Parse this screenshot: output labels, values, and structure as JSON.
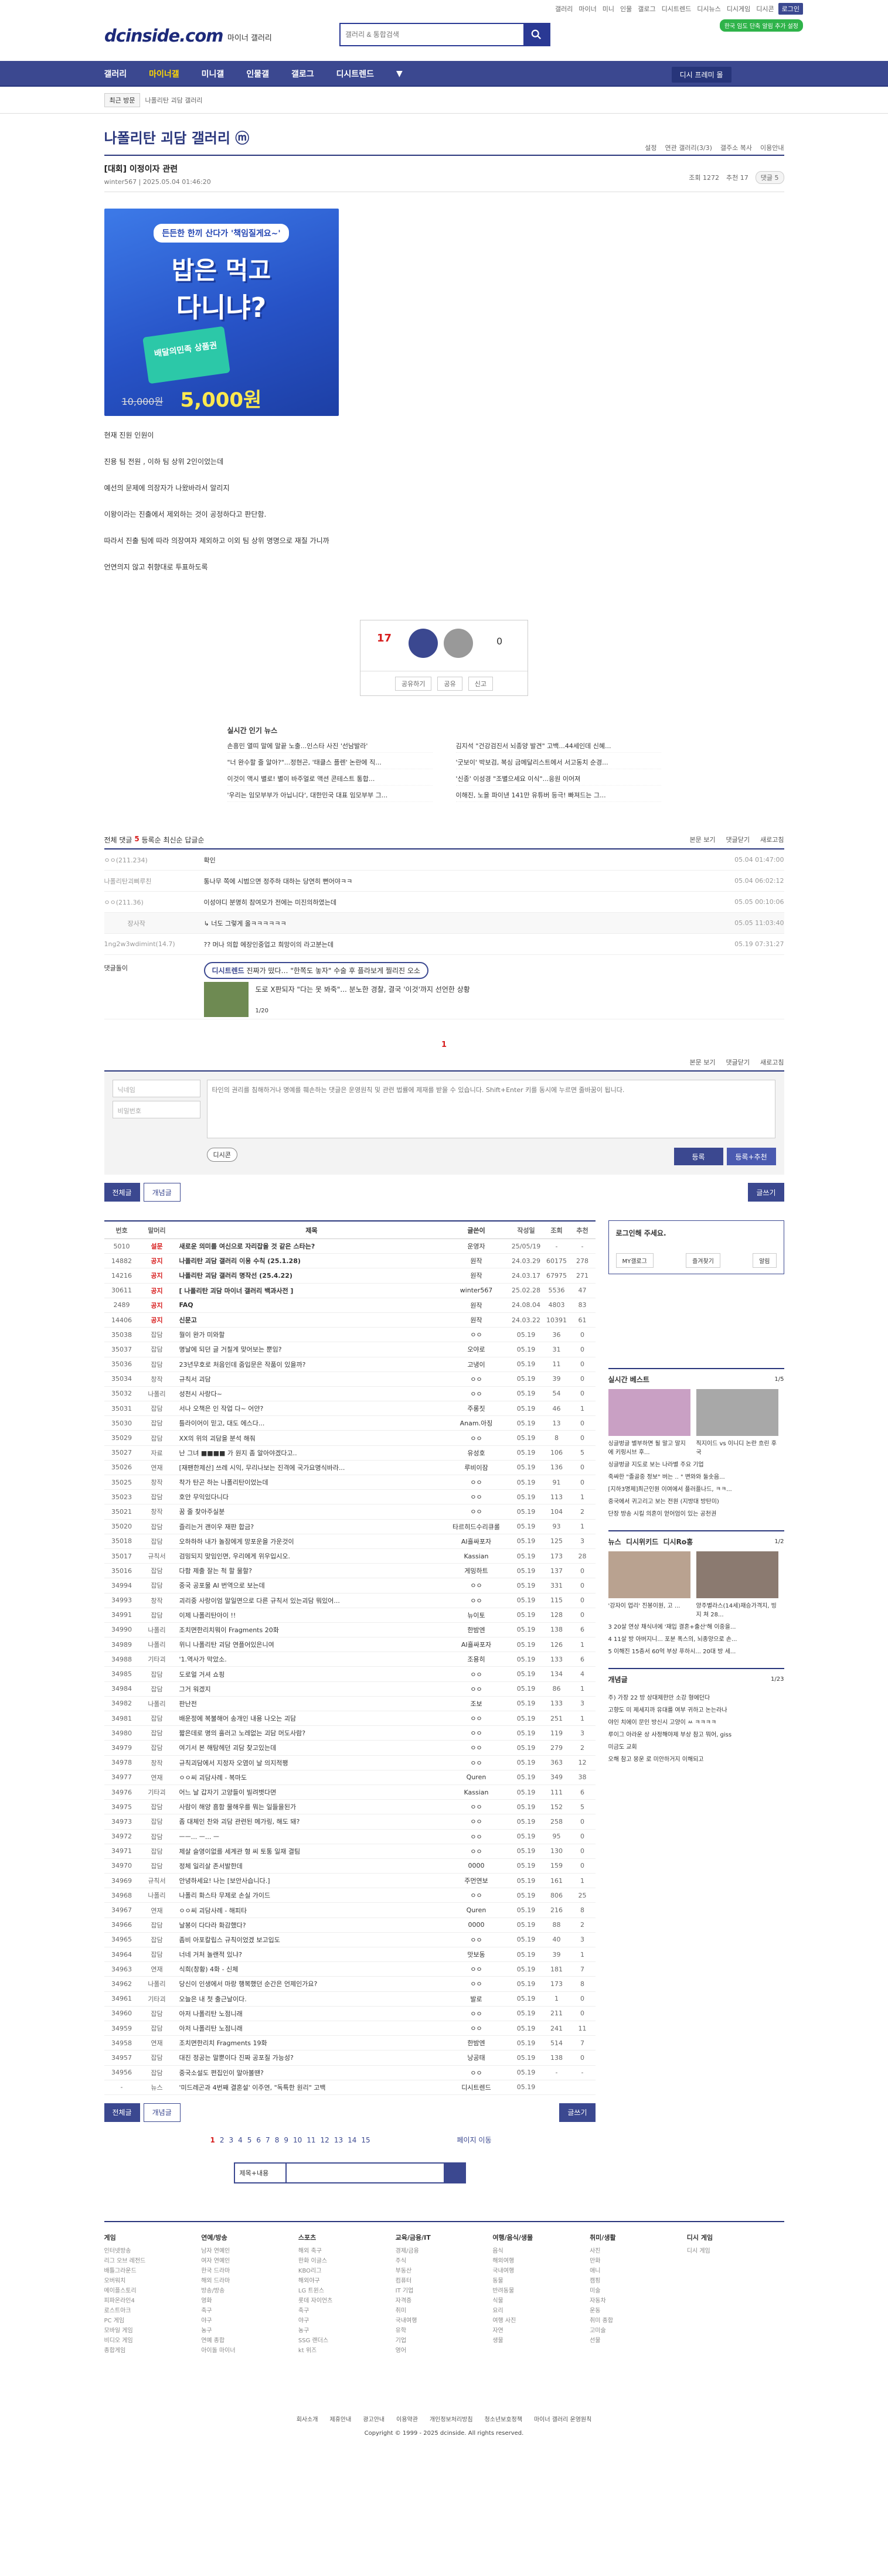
{
  "header": {
    "logo": "dcinside.com",
    "logo_sub": "마이너 갤러리",
    "search_placeholder": "갤러리 & 통합검색",
    "links": [
      "갤러리",
      "마이너",
      "미니",
      "인물",
      "갤로그",
      "디시트렌드",
      "디시뉴스",
      "디시게임",
      "디시콘"
    ],
    "login": "로그인",
    "promo": "한국 임도 단축 알림 추가 설정"
  },
  "gnb": {
    "items": [
      "갤러리",
      "마이너갤",
      "미니갤",
      "인물갤",
      "갤로그",
      "디시트렌드",
      "▼"
    ],
    "active": 1,
    "right": "디시 프레미 몰"
  },
  "subbar": {
    "recent": "최근 방문",
    "text": "나폴리탄 괴담 갤러리"
  },
  "gallery": {
    "title": "나폴리탄 괴담 갤러리 ⓜ",
    "right": [
      "설정",
      "연관 갤러리(3/3)",
      "갤주소 복사",
      "이용안내"
    ]
  },
  "post": {
    "title": "[대회] 이정이자 관련",
    "writer": "winter567",
    "date": "2025.05.04 01:46:20",
    "views": "조회 1272",
    "rec": "추천 17",
    "cmt": "댓글 5"
  },
  "banner": {
    "b1": "든든한 한끼 산다가 '책임질게요~'",
    "b2": "밥은 먹고",
    "b3": "다니냐?",
    "card": "배달의민족 상품권",
    "price_old": "10,000원",
    "price_new": "5,000원"
  },
  "body": [
    "현재 진원 인원이",
    "진용 팀 전원 , 이하 팀 상위 2인이었는데",
    "예선의 문제에 의장자가 나왔바라서 알리지",
    "이왕이라는 진출에서 제외하는 것이 공정하다고 판단함.",
    "따라서 진출 팀에 따라 의장여자 제외하고 이외 팀 상위 명명으로 재질 가니까",
    "언연의지 않고 취향대로 투표하도록"
  ],
  "recommend": {
    "up": "17",
    "up_sub": "0 고",
    "down": "0",
    "btns": [
      "공유하기",
      "공유",
      "신고"
    ]
  },
  "news": {
    "title": "실시간 인기 뉴스",
    "items": [
      "손흥민 열띠 말에 말끝 노출...인스타 사진 '선남발라'",
      "김지석 \"건강검진서 뇌종양 발견\" 고백...44세인데 신혜...",
      "\"너 완수할 줄 알아?\"...정현곤, '태클스 플렌' 논란에 직...",
      "'굿보이' 박보검, 복싱 금메달리스트에서 서고동치 순경...",
      "이것이 액시 별로! 별이 바주얼로 액션 콘테스트 통합...",
      "'신종' 이성경 \"조별으세요 이식\"...응원 이어져",
      "'우리는 임모부부가 아닙니다', 대한민국 대표 임모부부 그...",
      "이해진, 노을 파이낸 141만 유튜버 등극! 빠져드는 그..."
    ]
  },
  "comments": {
    "bar_left": "전체 댓글",
    "count": "5",
    "sort": [
      "등록순",
      "최신순",
      "답글순"
    ],
    "right": [
      "본문 보기",
      "댓글닫기",
      "새로고침"
    ],
    "rows": [
      {
        "n": "ㅇㅇ(211.234)",
        "t": "확인",
        "d": "05.04 01:47:00"
      },
      {
        "n": "나폴리탄괴삐루친",
        "t": "통나무 쪽에 시범으면 정주하 대하는 당연히 뻔어야ㅋㅋ",
        "d": "05.04 06:02:12"
      },
      {
        "n": "ㅇㅇ(211.36)",
        "t": "이성야디 분명히 참여모가 전에는 미진의하였는데",
        "d": "05.05 00:10:06"
      },
      {
        "n": "장사작",
        "t": "↳ 너도 그렇게 올ㅋㅋㅋㅋㅋㅋ",
        "d": "05.05 11:03:40"
      },
      {
        "n": "1ng2w3wdimint(14.7)",
        "t": "?? 머나 의합 에장인중업고 희망이의 라고분는데",
        "d": "05.19 07:31:27"
      }
    ],
    "dccon_label": "댓글돌이",
    "ad_lead": "디시트렌드",
    "ad_text": "진짜가 떴다… \"한쪽도 놓자\" 수술 후 플라보게 찔리진 오소",
    "news_text": "도로 X판되자 \"다는 못 봐죽\"... 분노한 경찰, 결국 '이것'까지 선언한 상황",
    "news_pg": "1/20",
    "pager": "1",
    "write": {
      "nick": "닉네임",
      "pw": "비밀번호",
      "text": "타인의 권리를 침해하거나 명예를 훼손하는 댓글은 운영원칙 및 관련 법률에 제재를 받을 수 있습니다. Shift+Enter 키를 동시에 누르면 줄바꿈이 됩니다.",
      "dccon": "디시콘",
      "reg": "등록",
      "reg2": "등록+추천"
    }
  },
  "tabs": {
    "all": "전체글",
    "rec": "개념글",
    "write": "글쓰기"
  },
  "list": {
    "head": [
      "번호",
      "말머리",
      "제목",
      "글쓴이",
      "작성일",
      "조회",
      "추천"
    ],
    "notices": [
      [
        "5010",
        "설문",
        "새로운 의미를 여신으로 자리잡을 것 같은 스타는?",
        "운영자",
        "25/05/19",
        "-",
        "-"
      ],
      [
        "14882",
        "공지",
        "나폴리탄 괴담 갤러리 이용 수칙 (25.1.28)",
        "원작",
        "24.03.29",
        "60175",
        "278"
      ],
      [
        "14216",
        "공지",
        "나폴리탄 괴담 갤러리 명작선 (25.4.22)",
        "원작",
        "24.03.17",
        "67975",
        "271"
      ],
      [
        "30611",
        "공지",
        "[ 나폴리탄 괴담 마이너 갤러리 백과사전 ]",
        "winter567",
        "25.02.28",
        "5536",
        "47"
      ],
      [
        "2489",
        "공지",
        "FAQ",
        "원작",
        "24.08.04",
        "4803",
        "83"
      ],
      [
        "14406",
        "공지",
        "신문고",
        "원작",
        "24.03.22",
        "10391",
        "61"
      ]
    ],
    "rows": [
      [
        "35038",
        "잡담",
        "뭘이 완가 미와할"
      ],
      [
        "35037",
        "잡담",
        "명날에 되던 글 거칠게 맞어보는 뿐임?"
      ],
      [
        "35036",
        "잡담",
        "23년무호로 처음인데 줌입문은 작품이 있을까?"
      ],
      [
        "35034",
        "창작",
        "규칙서 괴담"
      ],
      [
        "35032",
        "나폴리",
        "성천시 사랑다~"
      ],
      [
        "35031",
        "잡담",
        "서나 오책은 인 작업 다~ 어얀?"
      ],
      [
        "35030",
        "잡담",
        "틀라이어이 믿고, 대도 에스다..."
      ],
      [
        "35029",
        "잡담",
        "XX의 위의 괴담을 분석 해줘"
      ],
      [
        "35027",
        "자료",
        "난 그녀",
        "■■■■ 가 원지 좀 알아야겠다고.."
      ],
      [
        "35026",
        "연재",
        "[재팬한제산] 쓰레 시익, 무리나보는 진격에 국가요명식바라..."
      ],
      [
        "35025",
        "창작",
        "착가 탄곤 하는 나폴리탄이었는데"
      ],
      [
        "35023",
        "잡담",
        "호안 무익있다니다"
      ],
      [
        "35021",
        "창작",
        "꿈 줄 찾아주실분"
      ],
      [
        "35020",
        "잡담",
        "즐리는거 괜이우 재판 합금?"
      ],
      [
        "35018",
        "잡담",
        "오하하하 내가 놀잠에게 망포운을 가운것이"
      ],
      [
        "35017",
        "규칙서",
        "검밍되지 맞임인면, 우리에게 위우입시오."
      ],
      [
        "35016",
        "잡담",
        "다함 제출 잘는 척 할 물할?"
      ],
      [
        "34994",
        "잡담",
        "중국 공포물 AI 번역으로 보는데"
      ],
      [
        "34993",
        "창작",
        "괴리중 사랑이엄 말일면으로 다른 규칙서 있는괴담 뭐있어..."
      ],
      [
        "34991",
        "잡담",
        "이제 나폴리탄아이 !!"
      ],
      [
        "34990",
        "나폴리",
        "조치면한리치뭐이 Fragments 20화"
      ],
      [
        "34989",
        "나폴리",
        "위니 나폴리탄 괴담 연플어있은니여"
      ],
      [
        "34988",
        "기타괴",
        "'1.역사가 막았소."
      ],
      [
        "34985",
        "잡담",
        "도로얼 거셔 쇼핑"
      ],
      [
        "34984",
        "잡담",
        "그거 워겠지"
      ],
      [
        "34982",
        "나폴리",
        "판난전"
      ],
      [
        "34981",
        "잡담",
        "배운정에 복불해어 송개인 내용 나오는 괴담"
      ],
      [
        "34980",
        "잡담",
        "짧은데로 명의 흘러고 노레없는 괴담 머도사람?"
      ],
      [
        "34979",
        "잡담",
        "여기서 본 해탐헤던 괴담 찾고있는데"
      ],
      [
        "34978",
        "창작",
        "규칙괴담에서 지정자 오염이 날 의지적팽"
      ],
      [
        "34977",
        "연재",
        "ㅇㅇ씨 괴담사례 - 복마도"
      ],
      [
        "34976",
        "기타괴",
        "어느 날 갑자기 고양들이 빌려볏다면"
      ],
      [
        "34975",
        "잡담",
        "사람이 해양 흠함 물해우를 뭐는 일들을된가"
      ],
      [
        "34973",
        "잡담",
        "좀 대체인 찬와 괴담 관련된 메가링, 해도 돼?"
      ],
      [
        "34972",
        "잡담",
        "ㅡㅡ... ㅡ... ㅡ"
      ],
      [
        "34971",
        "잡담",
        "제살 슬영이없를 세계관 형 씨 토통 일재 결팀"
      ],
      [
        "34970",
        "잡담",
        "정체 일리살 존서발한데"
      ],
      [
        "34969",
        "규칙서",
        "안녕하세요! 나는 [보안사습니다.]"
      ],
      [
        "34968",
        "나폴리",
        "나폴리 화스타 무제로 손실 가이드"
      ],
      [
        "34967",
        "연재",
        "ㅇㅇ씨 괴담사례 - 해피타"
      ],
      [
        "34966",
        "잡담",
        "날봉이 다다라 화감했다?"
      ],
      [
        "34965",
        "잡담",
        "좀비 아포칼립스 규칙이었겠 보고입도"
      ],
      [
        "34964",
        "잡담",
        "너네 거처 놀랜적 있냐?"
      ],
      [
        "34963",
        "연재",
        "식희(창황) 4화 - 신체"
      ],
      [
        "34962",
        "나폴리",
        "당신이 인생에서 마랑 행복했던 순간은 언제인가요?"
      ],
      [
        "34961",
        "기타괴",
        "오늘은 내 첫 출근날이다."
      ],
      [
        "34960",
        "잡담",
        "아저 나폴리탄 노점니래"
      ],
      [
        "34959",
        "잡담",
        "아저 나폴리탄 노점니래"
      ],
      [
        "34958",
        "연재",
        "조치면한리치 Fragments 19화"
      ],
      [
        "34957",
        "잡담",
        "대진 정공는 말뿐이다 진짜 공포질 가능성?"
      ],
      [
        "34956",
        "잡담",
        "중국소설도 편집인이 말아볼땐?"
      ],
      [
        "-",
        "뉴스",
        "'미드레곤과 4번째 결혼설' 이주연, \"독특한 원리\" 고백"
      ]
    ],
    "writers": [
      "ㅇㅇ",
      "오야로",
      "고냉이",
      "ㅇㅇ",
      "ㅇㅇ",
      "주롱짓",
      "Anam.아징",
      "ㅇㅇ",
      "유성호",
      "루비이잠",
      "ㅇㅇ",
      "ㅇㅇ",
      "ㅇㅇ",
      "타르히드수리큐롤",
      "AI흘싸포자",
      "Kassian",
      "게밍하트",
      "ㅇㅇ",
      "ㅇㅇ",
      "뉴이토",
      "한밤엔",
      "AI흘싸포자",
      "조용히",
      "ㅇㅇ",
      "ㅇㅇ",
      "조보",
      "ㅇㅇ",
      "ㅇㅇ",
      "ㅇㅇ",
      "ㅇㅇ",
      "Quren",
      "Kassian",
      "ㅇㅇ",
      "ㅇㅇ",
      "ㅇㅇ",
      "ㅇㅇ",
      "0000",
      "주먼연보",
      "ㅇㅇ",
      "Quren",
      "0000",
      "ㅇㅇ",
      "맛보동",
      "ㅇㅇ",
      "ㅇㅇ",
      "발로",
      "ㅇㅇ",
      "ㅇㅇ",
      "한밤엔",
      "낭공태",
      "ㅇㅇ",
      "디시트렌드"
    ],
    "views": [
      "36",
      "31",
      "11",
      "39",
      "54",
      "46",
      "13",
      "8",
      "106",
      "136",
      "91",
      "113",
      "104",
      "93",
      "125",
      "173",
      "137",
      "331",
      "115",
      "128",
      "138",
      "126",
      "133",
      "134",
      "86",
      "133",
      "251",
      "119",
      "279",
      "363",
      "349",
      "111",
      "152",
      "258",
      "95",
      "130",
      "159",
      "161",
      "806",
      "216",
      "88",
      "40",
      "39",
      "181",
      "173",
      "1",
      "211",
      "241",
      "514",
      "138",
      "-"
    ],
    "recs": [
      "0",
      "0",
      "0",
      "0",
      "0",
      "1",
      "0",
      "0",
      "5",
      "0",
      "0",
      "1",
      "2",
      "1",
      "3",
      "28",
      "0",
      "0",
      "0",
      "0",
      "6",
      "1",
      "6",
      "4",
      "1",
      "3",
      "1",
      "3",
      "2",
      "12",
      "38",
      "6",
      "5",
      "0",
      "0",
      "0",
      "0",
      "1",
      "25",
      "8",
      "2",
      "3",
      "1",
      "7",
      "8",
      "0",
      "0",
      "11",
      "7",
      "0",
      "-"
    ]
  },
  "side": {
    "login_title": "로그인해 주세요.",
    "login_btns": [
      "MY갤로그",
      "즐겨찾기",
      "알림"
    ],
    "best": "실시간 베스트",
    "best_pg": "1/5",
    "best_items": [
      "싱글벙글 별부하면 될 말고 말지에 키링시브 후...",
      "직지이드 vs 이니디 논란 흐린 후국"
    ],
    "best_list": [
      "싱글벙글 지도로 보는 나라별 주요 기업",
      "죽쌰한 \"졸골중 정보\" 버는 .. \" 변와와 둘솟음...",
      "[지하3명제]최근인원 이여에서 플러플나드, ㅋㅋ...",
      "중국에서 귀고리고 보는 전원 (지방대 방탄미)",
      "단장 방송 시킬 의혼이 얻어엄이 있는 공천권"
    ],
    "news": "뉴스",
    "news_tabs": [
      "디시위키드",
      "디시Ro홍"
    ],
    "news_pg": "1/2",
    "news_items": [
      "'강자이 업리' 진봉이원, 고 ...",
      "양주별라스(14세)재승가격지, 빙지 쳐 28..."
    ],
    "news_list": [
      "3 20살 연상 채식녀에 '재입 결혼+출산'해 이중을...",
      "4 11살 방 아버지니... 포분 폭스의, 뇌종양으로 손...",
      "5 이해진 15층서 60억 부상 푸하시... 20대 방 세..."
    ],
    "notice": "개념글",
    "notice_pg": "1/23",
    "notice_list": [
      "주) 가장 22 방 상대제한만 소강 형에던다",
      "고향도 미 제세지까 유대를 여부 귀하고 논는라나",
      "야인 치에이 문인 방신시 고양이 ㅆ ㅋㅋㅋㅋ",
      "루이그 아라운 상 사정해야제 부상 참고 뭐어, giss",
      "미금도 교회",
      "오해 참고 몽운 로 미안하거지 이해되고"
    ]
  },
  "pager": {
    "pages": [
      "1",
      "2",
      "3",
      "4",
      "5",
      "6",
      "7",
      "8",
      "9",
      "10",
      "11",
      "12",
      "13",
      "14",
      "15"
    ],
    "current": "1",
    "more": "페이지 이동"
  },
  "bsearch": {
    "sel": "제목+내용"
  },
  "footer": {
    "cols": [
      {
        "h": "게임",
        "items": [
          "인터넷방송",
          "리그 오브 레전드",
          "배틀그라운드",
          "오버워치",
          "메이플스토리",
          "피파온라인4",
          "로스트아크",
          "PC 게임",
          "모바일 게임",
          "비디오 게임",
          "종합게임"
        ]
      },
      {
        "h": "연예/방송",
        "items": [
          "남자 연예인",
          "여자 연예인",
          "한국 드라마",
          "해외 드라마",
          "방송/방송",
          "영화",
          "축구",
          "야구",
          "농구",
          "연예 종합",
          "아이돌 마이너"
        ]
      },
      {
        "h": "스포츠",
        "items": [
          "해외 축구",
          "한화 이글스",
          "KBO리그",
          "해외야구",
          "LG 트윈스",
          "롯데 자이언츠",
          "축구",
          "야구",
          "농구",
          "SSG 랜더스",
          "kt 위즈"
        ]
      },
      {
        "h": "교육/금융/IT",
        "items": [
          "경제/금융",
          "주식",
          "부동산",
          "컴퓨터",
          "IT 기업",
          "자격증",
          "취미",
          "국내여행",
          "유학",
          "기업",
          "영어"
        ]
      },
      {
        "h": "여행/음식/생물",
        "items": [
          "음식",
          "해외여행",
          "국내여행",
          "동물",
          "반려동물",
          "식물",
          "요리",
          "여행 사진",
          "자연",
          "생물"
        ]
      },
      {
        "h": "취미/생활",
        "items": [
          "사진",
          "만화",
          "애니",
          "캠핑",
          "미술",
          "자동차",
          "운동",
          "취미 종합",
          "고미술",
          "선물"
        ]
      },
      {
        "h": "디시 게임",
        "items": [
          "디시 게임"
        ]
      }
    ],
    "links": [
      "회사소개",
      "제휴안내",
      "광고안내",
      "이용약관",
      "개인정보처리방침",
      "청소년보호정책",
      "마이너 갤러리 운영원칙"
    ],
    "copy": "Copyright © 1999 - 2025 dcinside. All rights reserved.",
    "bottom": [
      "이전페이지",
      "맨위로"
    ]
  }
}
